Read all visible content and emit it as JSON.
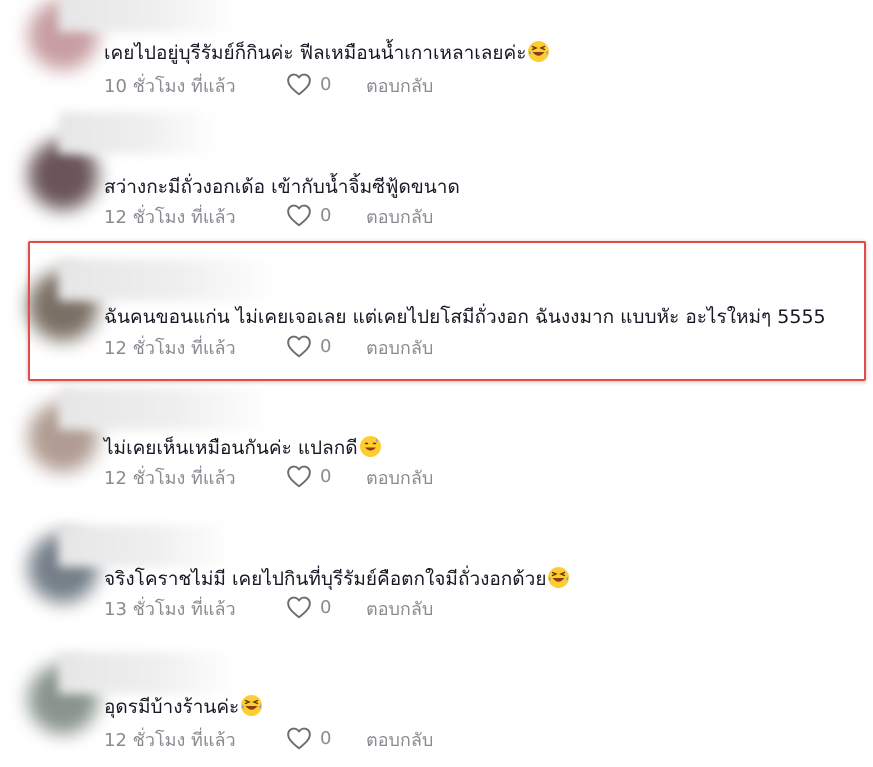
{
  "comments": [
    {
      "text": "เคยไปอยู่บุรีรัมย์ก็กินค่ะ ฟีลเหมือนน้ำเกาเหลาเลยค่ะ",
      "emoji": "laughing-emoji",
      "time": "10 ชั่วโมง ที่แล้ว",
      "likes": "0",
      "reply": "ตอบกลับ"
    },
    {
      "text": "สว่างกะมีถั่วงอกเด้อ เข้ากับน้ำจิ้มซีฟู้ดขนาด",
      "emoji": "",
      "time": "12 ชั่วโมง ที่แล้ว",
      "likes": "0",
      "reply": "ตอบกลับ"
    },
    {
      "text": "ฉันคนขอนแก่น ไม่เคยเจอเลย แต่เคยไปยโสมีถั่วงอก ฉันงงมาก แบบหัะ อะไรใหม่ๆ 5555",
      "emoji": "",
      "time": "12 ชั่วโมง ที่แล้ว",
      "likes": "0",
      "reply": "ตอบกลับ"
    },
    {
      "text": "ไม่เคยเห็นเหมือนกันค่ะ แปลกดี",
      "emoji": "sweat-smile-emoji",
      "time": "12 ชั่วโมง ที่แล้ว",
      "likes": "0",
      "reply": "ตอบกลับ"
    },
    {
      "text": "จริงโคราชไม่มี เคยไปกินที่บุรีรัมย์คือตกใจมีถั่วงอกด้วย",
      "emoji": "laughing-emoji",
      "time": "13 ชั่วโมง ที่แล้ว",
      "likes": "0",
      "reply": "ตอบกลับ"
    },
    {
      "text": "อุดรมีบ้างร้านค่ะ",
      "emoji": "laughing-emoji",
      "time": "12 ชั่วโมง ที่แล้ว",
      "likes": "0",
      "reply": "ตอบกลับ"
    }
  ],
  "colors": {
    "text": "#161823",
    "meta": "#8a8b91",
    "highlight": "#e44a4a",
    "emoji": "#ffcc33"
  }
}
